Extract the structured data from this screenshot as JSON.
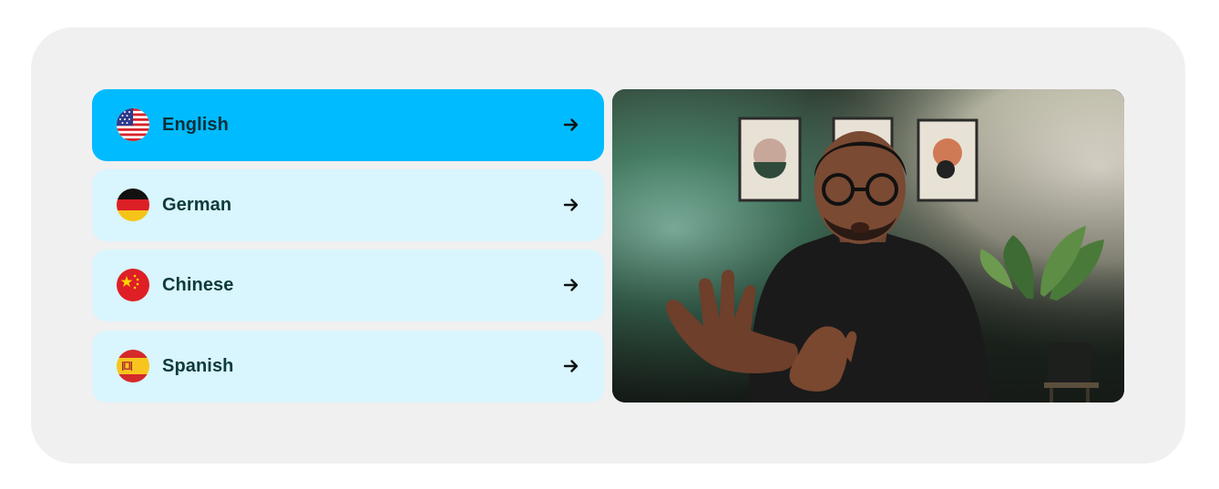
{
  "languages": [
    {
      "label": "English",
      "flag": "us-flag-icon",
      "active": true
    },
    {
      "label": "German",
      "flag": "germany-flag-icon",
      "active": false
    },
    {
      "label": "Chinese",
      "flag": "china-flag-icon",
      "active": false
    },
    {
      "label": "Spanish",
      "flag": "spain-flag-icon",
      "active": false
    }
  ],
  "colors": {
    "card_background": "#f0f0f0",
    "active_item": "#00bbff",
    "inactive_item": "#d9f5fd",
    "label_text": "#0d3a3a"
  },
  "video": {
    "description_icon": "presenter-video-thumbnail"
  }
}
